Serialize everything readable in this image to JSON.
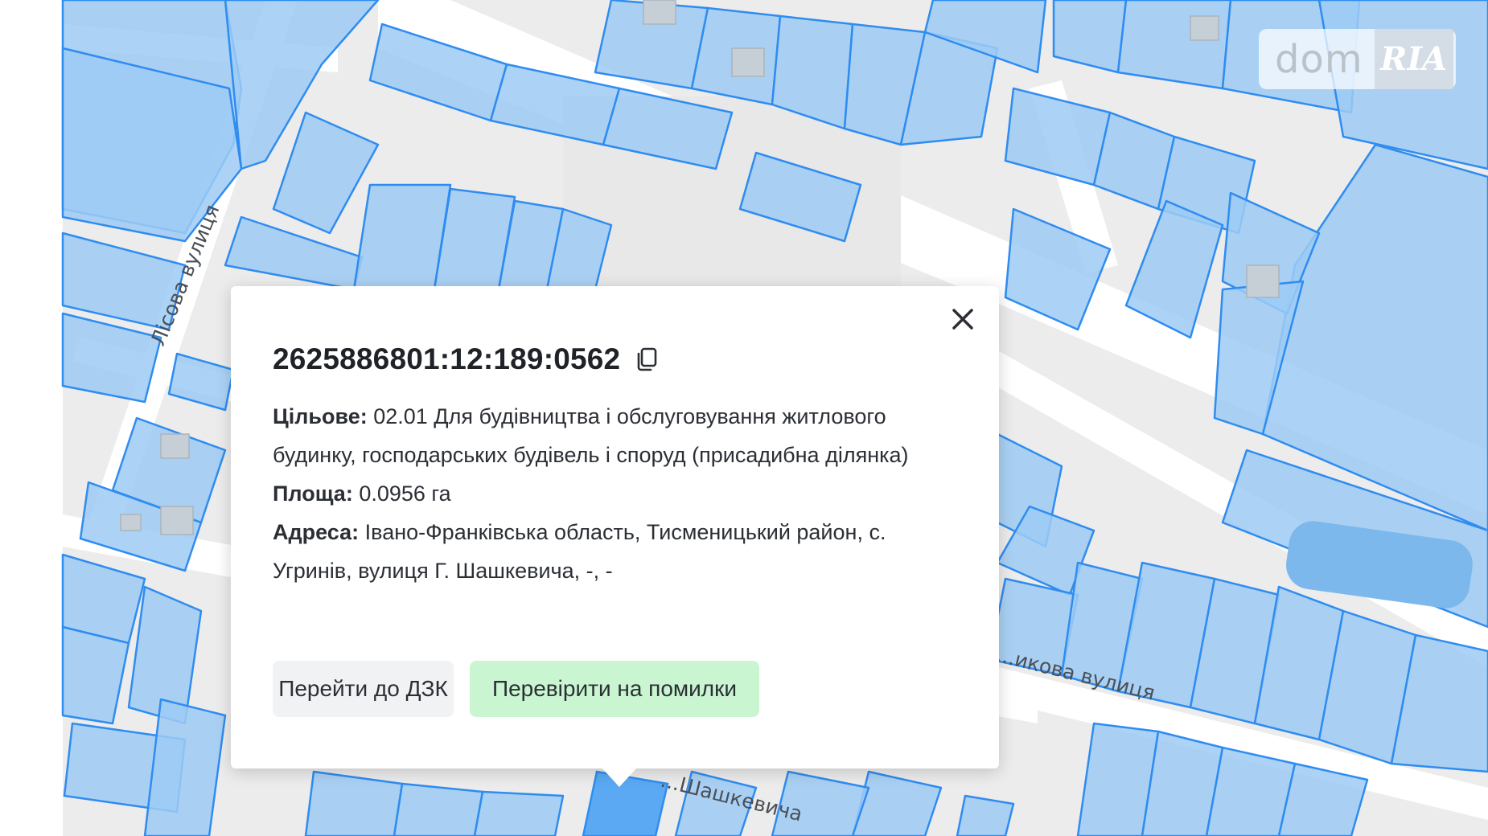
{
  "map": {
    "roads": [
      "Лісова вулиця",
      "...икова вулиця",
      "...Шашкевича"
    ],
    "parcel_fill": "#9ecbf4",
    "parcel_stroke": "#2f8cf0",
    "selected_fill": "#5aa9f2"
  },
  "watermark": {
    "dom": "dom",
    "ria": "RIA"
  },
  "popup": {
    "cadastral_number": "2625886801:12:189:0562",
    "purpose_label": "Цільове:",
    "purpose_value": "02.01 Для будівництва і обслуговування житлового будинку, господарських будівель і споруд (присадибна ділянка)",
    "area_label": "Площа:",
    "area_value": "0.0956 га",
    "address_label": "Адреса:",
    "address_value": "Івано-Франківська область, Тисменицький район, с. Угринів, вулиця Г. Шашкевича, -, -",
    "button_dzk": "Перейти до ДЗК",
    "button_check": "Перевірити на помилки",
    "close_icon": "close-icon",
    "copy_icon": "copy-icon"
  }
}
